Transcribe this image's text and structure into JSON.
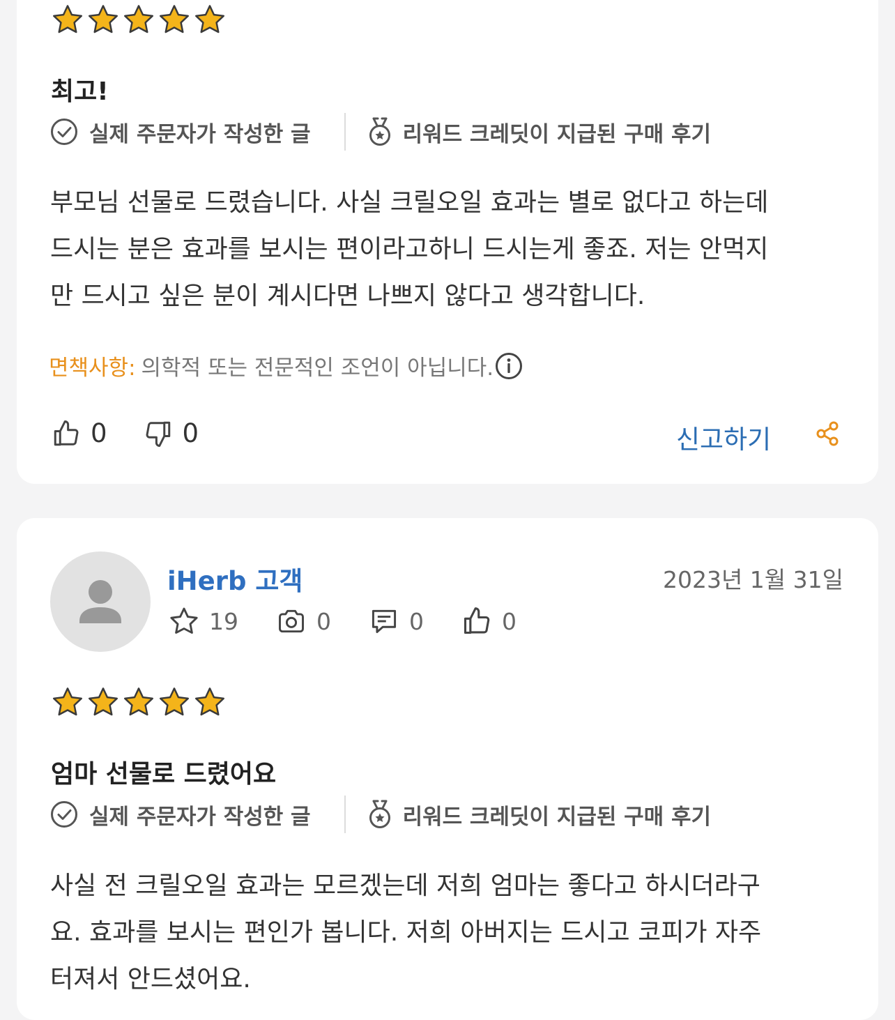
{
  "colors": {
    "star": "#f4b41a",
    "link_blue": "#2b6db3",
    "username_blue": "#2f6fc0",
    "disclaimer_orange": "#e8901c",
    "share_orange": "#e8901c"
  },
  "reviews": [
    {
      "rating": 5,
      "title": "최고!",
      "verified_label": "실제 주문자가 작성한 글",
      "reward_label": "리워드 크레딧이 지급된 구매 후기",
      "body_lines": [
        "부모님 선물로 드렸습니다. 사실 크릴오일 효과는 별로 없다고 하는데",
        "드시는 분은 효과를 보시는 편이라고하니 드시는게 좋죠. 저는 안먹지",
        "만 드시고 싶은 분이 계시다면 나쁘지 않다고 생각합니다."
      ],
      "disclaimer_label": "면책사항:",
      "disclaimer_text": "의학적 또는 전문적인 조언이 아닙니다.",
      "helpful_count": "0",
      "unhelpful_count": "0",
      "report_label": "신고하기"
    },
    {
      "username": "iHerb 고객",
      "date": "2023년 1월 31일",
      "stats": {
        "reviews": "19",
        "photos": "0",
        "comments": "0",
        "helpful": "0"
      },
      "rating": 5,
      "title": "엄마 선물로 드렸어요",
      "verified_label": "실제 주문자가 작성한 글",
      "reward_label": "리워드 크레딧이 지급된 구매 후기",
      "body_lines": [
        "사실 전 크릴오일 효과는 모르겠는데 저희 엄마는 좋다고 하시더라구",
        "요. 효과를 보시는 편인가 봅니다. 저희 아버지는 드시고 코피가 자주",
        "터져서 안드셨어요."
      ]
    }
  ]
}
